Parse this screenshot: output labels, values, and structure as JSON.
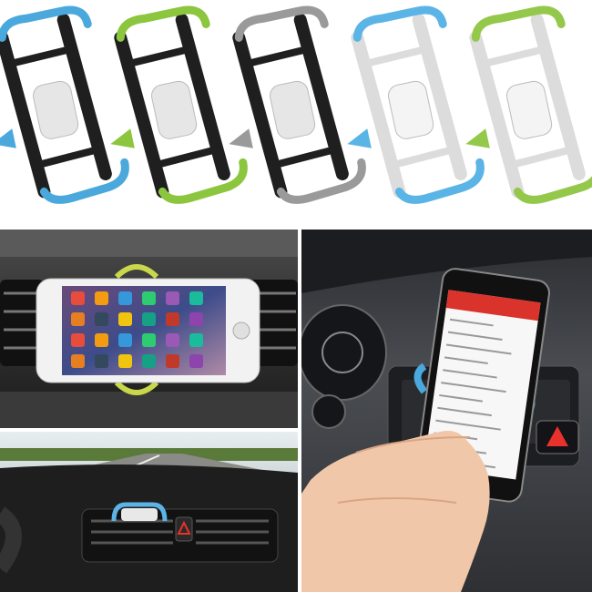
{
  "catalog": {
    "variants": [
      {
        "frame": "black",
        "accent": "blue",
        "frame_color": "#1f1f1f",
        "accent_color": "#4aa8dc",
        "pad_color": "#e6e6e6"
      },
      {
        "frame": "black",
        "accent": "green",
        "frame_color": "#1f1f1f",
        "accent_color": "#8cc63f",
        "pad_color": "#e6e6e6"
      },
      {
        "frame": "black",
        "accent": "gray",
        "frame_color": "#1f1f1f",
        "accent_color": "#9a9a9a",
        "pad_color": "#e6e6e6"
      },
      {
        "frame": "white",
        "accent": "blue",
        "frame_color": "#dcdcdc",
        "accent_color": "#5ab4e6",
        "pad_color": "#f4f4f4"
      },
      {
        "frame": "white",
        "accent": "green",
        "frame_color": "#dcdcdc",
        "accent_color": "#94c84a",
        "pad_color": "#f4f4f4"
      }
    ]
  },
  "scenes": {
    "vent_closeup": {
      "holder_accent": "#c9d84a",
      "phone_frame": "#f2f2f2"
    },
    "car_interior": {
      "holder_accent": "#5ab4e6"
    },
    "dashboard_hand": {
      "holder_accent": "#4aa8dc",
      "phone_header": "#d9332b",
      "hazard": "#e8322b"
    }
  }
}
